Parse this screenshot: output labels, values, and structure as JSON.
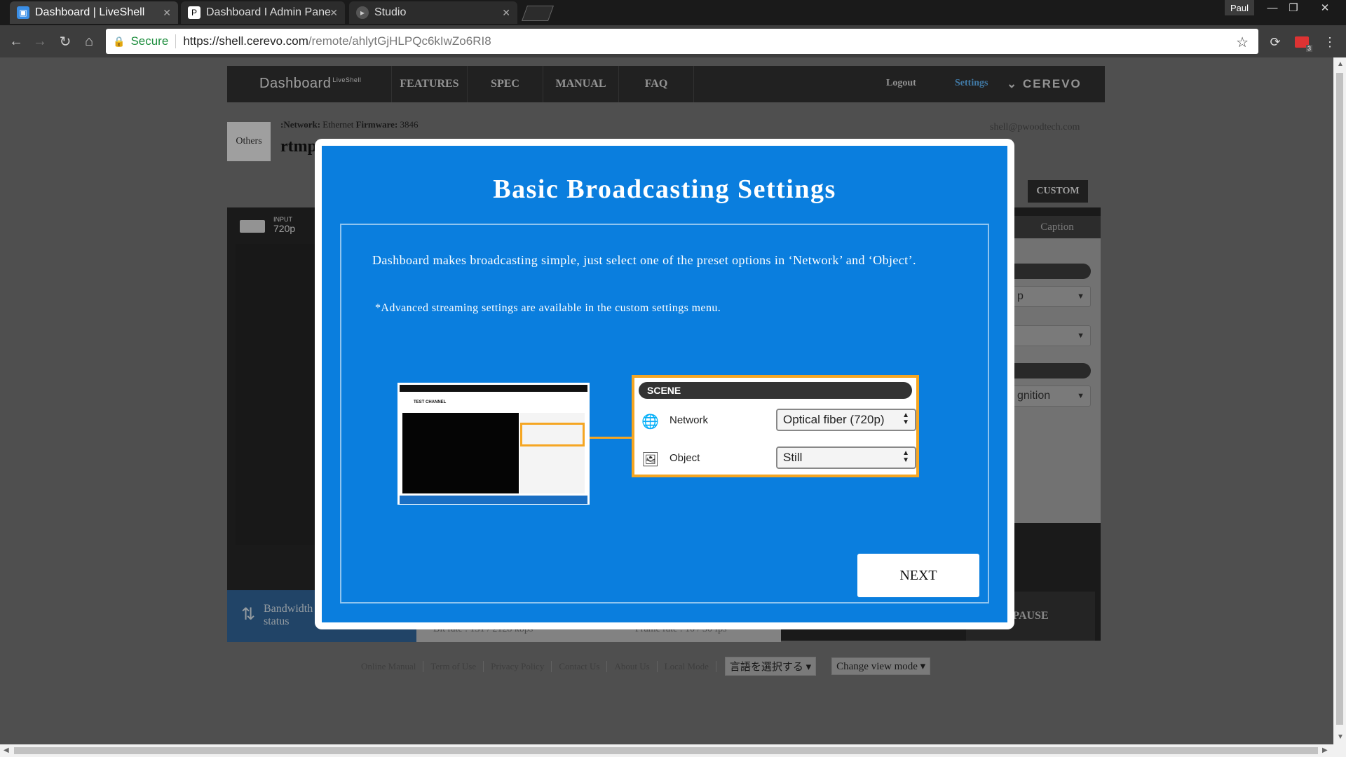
{
  "browser": {
    "tabs": [
      {
        "title": "Dashboard | LiveShell",
        "active": true
      },
      {
        "title": "Dashboard I Admin Pane",
        "active": false
      },
      {
        "title": "Studio",
        "active": false
      }
    ],
    "profile": "Paul",
    "security_label": "Secure",
    "url_host": "https://shell.cerevo.com",
    "url_path": "/remote/ahlytGjHLPQc6kIwZo6RI8",
    "extension_badge": "3"
  },
  "navbar": {
    "brand": "Dashboard",
    "brand_sup": "LiveShell",
    "items": [
      "FEATURES",
      "SPEC",
      "MANUAL",
      "FAQ"
    ],
    "logout": "Logout",
    "settings": "Settings",
    "logo": "CEREVO"
  },
  "header": {
    "others": "Others",
    "network_label": ":Network:",
    "network_value": "Ethernet",
    "firmware_label": "Firmware:",
    "firmware_value": "3846",
    "channel": "rtmp",
    "email": "shell@pwoodtech.com",
    "custom_button": "CUSTOM"
  },
  "panel": {
    "input_label": "INPUT",
    "input_value": "720p",
    "caption_tab": "Caption",
    "select1_text": "p",
    "select3_text": "gnition",
    "bandwidth_line1": "Bandwidth",
    "bandwidth_line2": "status",
    "bitrate_text": "Bit rate : 131 / 2128 kbps",
    "framerate_text": "Frame rate : 10 / 30 fps",
    "pause_button": "PAUSE"
  },
  "footer": {
    "links": [
      "Online Manual",
      "Term of Use",
      "Privacy Policy",
      "Contact Us",
      "About Us",
      "Local Mode"
    ],
    "language_select": "言語を選択する ▾",
    "view_mode_select": "Change view mode ▾"
  },
  "modal": {
    "title": "Basic Broadcasting Settings",
    "description": "Dashboard makes broadcasting simple, just select one of the preset options in ‘Network’ and ‘Object’.",
    "note": "*Advanced streaming settings are available in the custom settings menu.",
    "thumbnail_title": "TEST CHANNEL",
    "scene_header": "SCENE",
    "network_label": "Network",
    "network_value": "Optical fiber (720p)",
    "object_label": "Object",
    "object_value": "Still",
    "next_button": "NEXT"
  },
  "colors": {
    "modal_blue": "#0a7ede",
    "highlight_orange": "#f5a623",
    "settings_link": "#5aa9e6"
  }
}
